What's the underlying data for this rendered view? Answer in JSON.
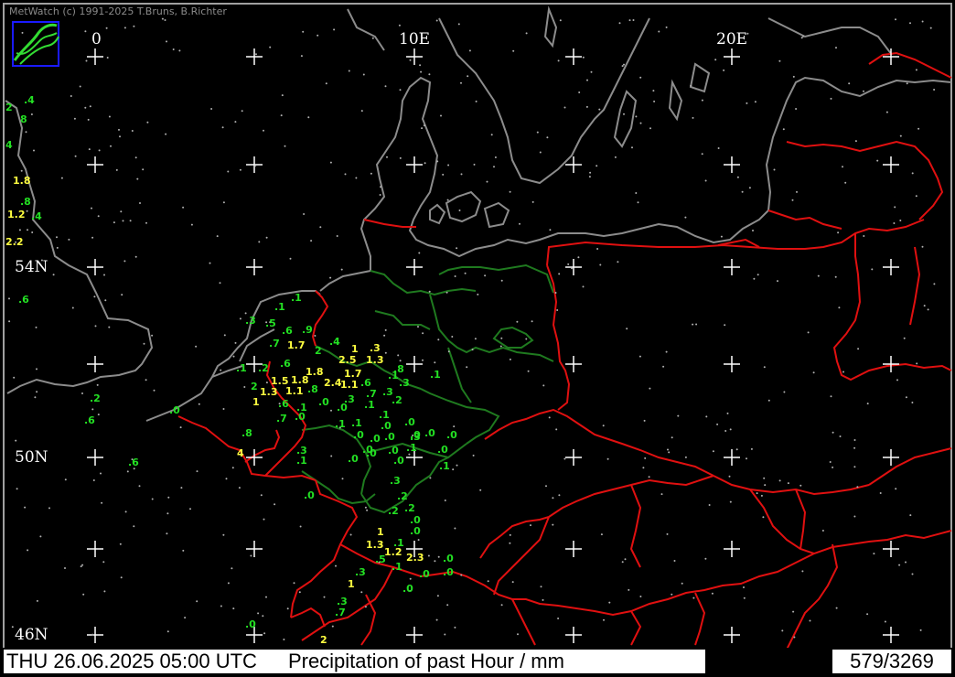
{
  "copyright": "MetWatch  (c) 1991-2025 T.Bruns, B.Richter",
  "longitude_labels": [
    "0",
    "10E",
    "20E"
  ],
  "latitude_labels": [
    "54N",
    "50N",
    "46N"
  ],
  "footer": {
    "datetime": "THU 26.06.2025 05:00 UTC",
    "title": "Precipitation of past  Hour  / mm",
    "count": "579/3269"
  },
  "colors": {
    "coastline": "#8c8c8c",
    "national_border": "#e01010",
    "state_border": "#1f7a1f",
    "low_value": "#23e023",
    "high_value": "#ffff40",
    "grid": "#ffffff"
  },
  "logo_icon": "metwatch-logo-icon",
  "observations": [
    {
      "v": ".4",
      "c": "g"
    },
    {
      "v": "2",
      "c": "g"
    },
    {
      "v": "8",
      "c": "g"
    },
    {
      "v": "4",
      "c": "g"
    },
    {
      "v": "1.8",
      "c": "y"
    },
    {
      "v": ".8",
      "c": "g"
    },
    {
      "v": "1.2",
      "c": "y"
    },
    {
      "v": ".4",
      "c": "g"
    },
    {
      "v": "2.2",
      "c": "y"
    },
    {
      "v": ".6",
      "c": "g"
    },
    {
      "v": ".2",
      "c": "g"
    },
    {
      "v": ".6",
      "c": "g"
    },
    {
      "v": ".0",
      "c": "g"
    },
    {
      "v": ".8",
      "c": "g"
    },
    {
      "v": "4",
      "c": "y"
    },
    {
      "v": ".6",
      "c": "g"
    },
    {
      "v": ".1",
      "c": "g"
    },
    {
      "v": ".1",
      "c": "g"
    },
    {
      "v": ".3",
      "c": "g"
    },
    {
      "v": ".5",
      "c": "g"
    },
    {
      "v": ".6",
      "c": "g"
    },
    {
      "v": ".9",
      "c": "g"
    },
    {
      "v": ".7",
      "c": "g"
    },
    {
      "v": "1.7",
      "c": "y"
    },
    {
      "v": ".4",
      "c": "g"
    },
    {
      "v": "2",
      "c": "g"
    },
    {
      "v": "1",
      "c": "y"
    },
    {
      "v": ".3",
      "c": "y"
    },
    {
      "v": "2.5",
      "c": "y"
    },
    {
      "v": "1.3",
      "c": "y"
    },
    {
      "v": ".1",
      "c": "g"
    },
    {
      "v": ".2",
      "c": "g"
    },
    {
      "v": ".6",
      "c": "g"
    },
    {
      "v": ".8",
      "c": "g"
    },
    {
      "v": "1.8",
      "c": "y"
    },
    {
      "v": "1.7",
      "c": "y"
    },
    {
      "v": ".1",
      "c": "g"
    },
    {
      "v": ".1",
      "c": "g"
    },
    {
      "v": "1.5",
      "c": "y"
    },
    {
      "v": "1.8",
      "c": "y"
    },
    {
      "v": "2",
      "c": "g"
    },
    {
      "v": "1.3",
      "c": "y"
    },
    {
      "v": "1.1",
      "c": "y"
    },
    {
      "v": ".8",
      "c": "g"
    },
    {
      "v": "2.4",
      "c": "y"
    },
    {
      "v": "1.1",
      "c": "y"
    },
    {
      "v": ".6",
      "c": "g"
    },
    {
      "v": ".7",
      "c": "g"
    },
    {
      "v": ".3",
      "c": "g"
    },
    {
      "v": ".2",
      "c": "g"
    },
    {
      "v": "1",
      "c": "y"
    },
    {
      "v": ".6",
      "c": "g"
    },
    {
      "v": ".1",
      "c": "g"
    },
    {
      "v": ".3",
      "c": "g"
    },
    {
      "v": ".3",
      "c": "g"
    },
    {
      "v": ".1",
      "c": "g"
    },
    {
      "v": ".7",
      "c": "g"
    },
    {
      "v": ".0",
      "c": "g"
    },
    {
      "v": ".0",
      "c": "g"
    },
    {
      "v": ".0",
      "c": "g"
    },
    {
      "v": ".1",
      "c": "g"
    },
    {
      "v": ".1",
      "c": "g"
    },
    {
      "v": ".0",
      "c": "g"
    },
    {
      "v": ".0",
      "c": "g"
    },
    {
      "v": ".1",
      "c": "g"
    },
    {
      "v": ".0",
      "c": "g"
    },
    {
      "v": ".0",
      "c": "g"
    },
    {
      "v": ".0",
      "c": "g"
    },
    {
      "v": ".0",
      "c": "g"
    },
    {
      "v": ".0",
      "c": "g"
    },
    {
      "v": ".0",
      "c": "g"
    },
    {
      "v": ".3",
      "c": "g"
    },
    {
      "v": ".1",
      "c": "g"
    },
    {
      "v": ".0",
      "c": "g"
    },
    {
      "v": ".0",
      "c": "g"
    },
    {
      "v": ".0",
      "c": "g"
    },
    {
      "v": ".0",
      "c": "g"
    },
    {
      "v": ".3",
      "c": "g"
    },
    {
      "v": ".1",
      "c": "g"
    },
    {
      "v": ".0",
      "c": "g"
    },
    {
      "v": ".0",
      "c": "g"
    },
    {
      "v": ".3",
      "c": "g"
    },
    {
      "v": ".1",
      "c": "g"
    },
    {
      "v": ".2",
      "c": "g"
    },
    {
      "v": ".2",
      "c": "g"
    },
    {
      "v": ".2",
      "c": "g"
    },
    {
      "v": ".0",
      "c": "g"
    },
    {
      "v": ".0",
      "c": "g"
    },
    {
      "v": "1",
      "c": "y"
    },
    {
      "v": ".1",
      "c": "g"
    },
    {
      "v": "1.3",
      "c": "y"
    },
    {
      "v": "1.2",
      "c": "y"
    },
    {
      "v": "2.3",
      "c": "y"
    },
    {
      "v": ".0",
      "c": "g"
    },
    {
      "v": ".3",
      "c": "g"
    },
    {
      "v": ".5",
      "c": "g"
    },
    {
      "v": ".1",
      "c": "g"
    },
    {
      "v": ".0",
      "c": "g"
    },
    {
      "v": ".0",
      "c": "g"
    },
    {
      "v": "1",
      "c": "y"
    },
    {
      "v": ".0",
      "c": "g"
    },
    {
      "v": ".3",
      "c": "g"
    },
    {
      "v": ".7",
      "c": "g"
    },
    {
      "v": ".0",
      "c": "g"
    },
    {
      "v": "2",
      "c": "y"
    },
    {
      "v": ".0",
      "c": "g"
    }
  ]
}
